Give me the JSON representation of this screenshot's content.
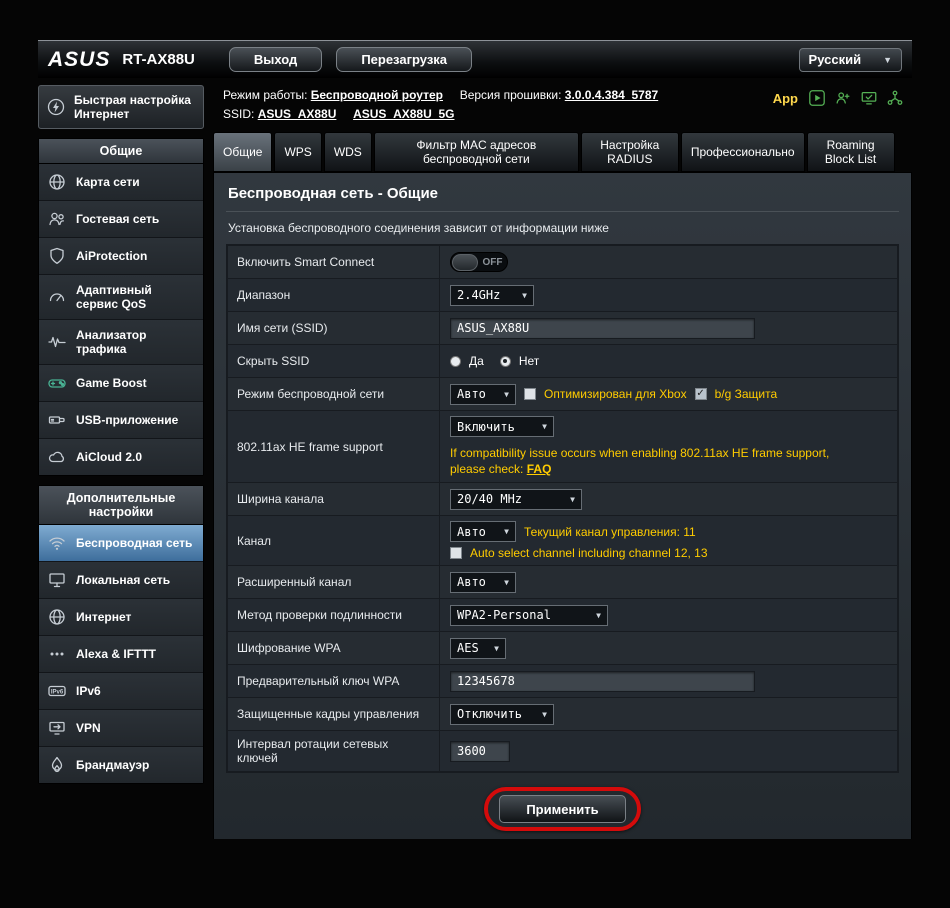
{
  "icons": {
    "chevron": "▼"
  },
  "header": {
    "brand": "ASUS",
    "model": "RT-AX88U",
    "logout": "Выход",
    "reboot": "Перезагрузка",
    "language": "Русский"
  },
  "infobar": {
    "mode_label": "Режим работы:",
    "mode_value": "Беспроводной роутер",
    "firmware_label": "Версия прошивки:",
    "firmware_value": "3.0.0.4.384_5787",
    "ssid_label": "SSID:",
    "ssid_1": "ASUS_AX88U",
    "ssid_2": "ASUS_AX88U_5G",
    "app_label": "App"
  },
  "sidebar": {
    "quick_setup": "Быстрая настройка Интернет",
    "section_general": "Общие",
    "section_advanced": "Дополнительные настройки",
    "general_items": [
      {
        "label": "Карта сети"
      },
      {
        "label": "Гостевая сеть"
      },
      {
        "label": "AiProtection"
      },
      {
        "label": "Адаптивный сервис QoS"
      },
      {
        "label": "Анализатор трафика"
      },
      {
        "label": "Game Boost"
      },
      {
        "label": "USB-приложение"
      },
      {
        "label": "AiCloud 2.0"
      }
    ],
    "advanced_items": [
      {
        "label": "Беспроводная сеть"
      },
      {
        "label": "Локальная сеть"
      },
      {
        "label": "Интернет"
      },
      {
        "label": "Alexa & IFTTT"
      },
      {
        "label": "IPv6"
      },
      {
        "label": "VPN"
      },
      {
        "label": "Брандмауэр"
      }
    ]
  },
  "tabs": [
    {
      "label": "Общие"
    },
    {
      "label": "WPS"
    },
    {
      "label": "WDS"
    },
    {
      "label": "Фильтр MAC адресов беспроводной сети"
    },
    {
      "label": "Настройка RADIUS"
    },
    {
      "label": "Профессионально"
    },
    {
      "label": "Roaming Block List"
    }
  ],
  "content": {
    "title": "Беспроводная сеть - Общие",
    "subtitle": "Установка беспроводного соединения зависит от информации ниже",
    "apply": "Применить"
  },
  "form": {
    "smart_connect": {
      "label": "Включить Smart Connect",
      "state": "OFF"
    },
    "band": {
      "label": "Диапазон",
      "value": "2.4GHz"
    },
    "ssid": {
      "label": "Имя сети (SSID)",
      "value": "ASUS_AX88U"
    },
    "hide_ssid": {
      "label": "Скрыть SSID",
      "yes": "Да",
      "no": "Нет"
    },
    "mode": {
      "label": "Режим беспроводной сети",
      "value": "Авто",
      "xbox": "Оптимизирован для Xbox",
      "bg": "b/g Защита"
    },
    "he_frame": {
      "label": "802.11ax HE frame support",
      "value": "Включить",
      "hint": "If compatibility issue occurs when enabling 802.11ax HE frame support, please check:",
      "link": "FAQ"
    },
    "width": {
      "label": "Ширина канала",
      "value": "20/40 MHz"
    },
    "channel": {
      "label": "Канал",
      "value": "Авто",
      "hint": "Текущий канал управления: 11",
      "auto_label": "Auto select channel including channel 12, 13"
    },
    "ext_channel": {
      "label": "Расширенный канал",
      "value": "Авто"
    },
    "auth": {
      "label": "Метод проверки подлинности",
      "value": "WPA2-Personal"
    },
    "wpa_enc": {
      "label": "Шифрование WPA",
      "value": "AES"
    },
    "wpa_key": {
      "label": "Предварительный ключ WPA",
      "value": "12345678"
    },
    "pmf": {
      "label": "Защищенные кадры управления",
      "value": "Отключить"
    },
    "rotation": {
      "label": "Интервал ротации сетевых ключей",
      "value": "3600"
    }
  }
}
